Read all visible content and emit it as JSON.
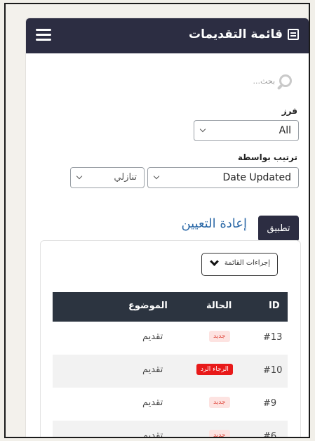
{
  "header": {
    "title": "قائمة التقديمات"
  },
  "search": {
    "placeholder": "بحث..."
  },
  "filter": {
    "sort_label": "فرز",
    "sort_value": "All",
    "order_by_label": "ترتيب بواسطة",
    "order_by_value": "Date Updated",
    "direction_value": "تنازلي"
  },
  "buttons": {
    "apply": "تطبيق",
    "reset": "إعادة التعيين"
  },
  "list_actions": {
    "label": "إجراءات القائمة"
  },
  "table": {
    "headers": {
      "id": "ID",
      "status": "الحالة",
      "subject": "الموضوع"
    },
    "rows": [
      {
        "id": "#13",
        "status": "جديد",
        "subject": "تقديم"
      },
      {
        "id": "#10",
        "status": "الرجاء الرد",
        "subject": "تقديم"
      },
      {
        "id": "#9",
        "status": "جديد",
        "subject": "تقديم"
      },
      {
        "id": "#6",
        "status": "جديد",
        "subject": "تقديم"
      }
    ]
  },
  "colors": {
    "header_bg": "#2c2d42",
    "table_head_bg": "#2c3440",
    "link": "#2d6aa8",
    "status_new_bg": "#fde3e1",
    "status_reply_bg": "#e81a1a"
  }
}
